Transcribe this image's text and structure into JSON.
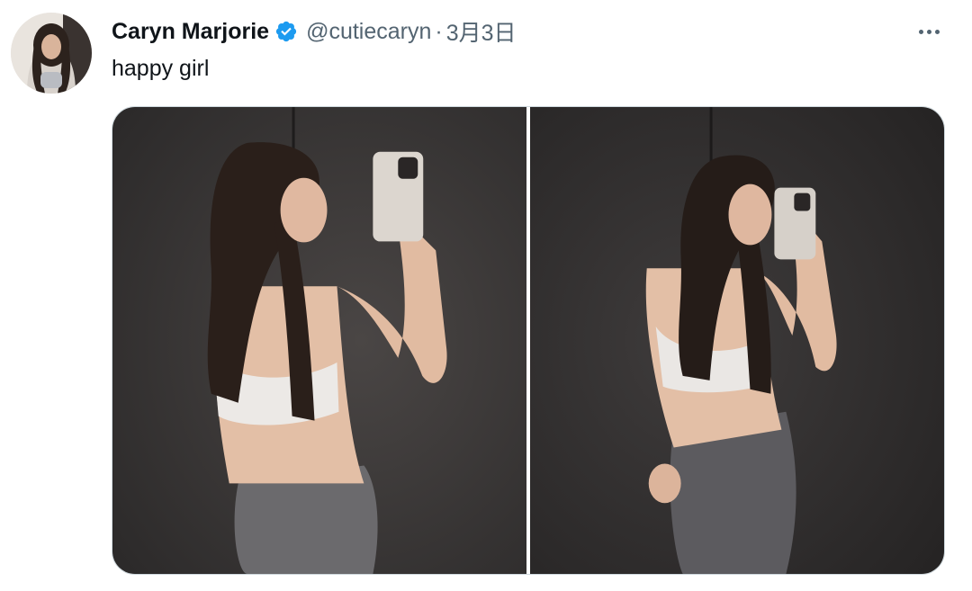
{
  "author": {
    "display_name": "Caryn Marjorie",
    "handle": "@cutiecaryn",
    "verified": true,
    "avatar_icon": "user-avatar-photo"
  },
  "meta": {
    "separator": "·",
    "date": "3月3日"
  },
  "tweet": {
    "text": "happy girl"
  },
  "menu": {
    "icon": "more-options-icon"
  },
  "media": {
    "count": 2,
    "items": [
      {
        "type": "photo",
        "icon": "photo-mirror-selfie"
      },
      {
        "type": "photo",
        "icon": "photo-mirror-selfie"
      }
    ]
  },
  "colors": {
    "text_primary": "#0f1419",
    "text_secondary": "#536471",
    "verified_blue": "#1d9bf0",
    "photo_background": "#3a3736"
  }
}
